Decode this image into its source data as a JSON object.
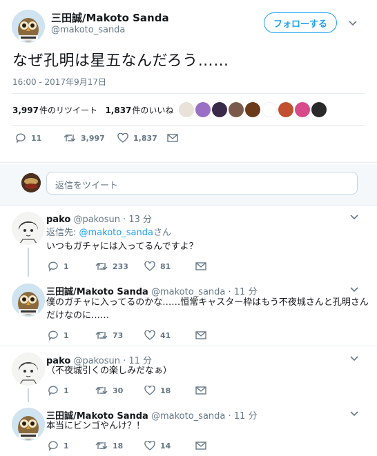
{
  "tweet": {
    "display_name": "三田誠/Makoto Sanda",
    "handle": "@makoto_sanda",
    "follow_label": "フォローする",
    "text": "なぜ孔明は星五なんだろう……",
    "timestamp": "16:00 - 2017年9月17日",
    "retweets_count": "3,997",
    "retweets_label": "件のリツイート",
    "likes_count": "1,837",
    "likes_label": "件のいいね",
    "actions": {
      "reply": "11",
      "retweet": "3,997",
      "like": "1,837"
    }
  },
  "reply_box": {
    "placeholder": "返信をツイート"
  },
  "replies": [
    {
      "name": "pako",
      "handle": "@pakosun",
      "time": "· 13 分",
      "replying_prefix": "返信先: ",
      "replying_to": "@makoto_sanda",
      "replying_suffix": "さん",
      "text": "いつもガチャには入ってるんですよ？",
      "reply": "1",
      "retweet": "233",
      "like": "81"
    },
    {
      "name": "三田誠/Makoto Sanda",
      "handle": "@makoto_sanda",
      "time": "· 11 分",
      "text1": "僕のガチャに入ってるのかな……恒常キャスター枠はもう不夜城さんと孔明さん",
      "text2": "だけなのに……",
      "reply": "1",
      "retweet": "73",
      "like": "41"
    },
    {
      "name": "pako",
      "handle": "@pakosun",
      "time": "· 11 分",
      "text": "（不夜城引くの楽しみだなぁ）",
      "reply": "1",
      "retweet": "30",
      "like": "18"
    },
    {
      "name": "三田誠/Makoto Sanda",
      "handle": "@makoto_sanda",
      "time": "· 11 分",
      "text": "本当にビンゴやんけ？！",
      "reply": "1",
      "retweet": "18",
      "like": "14"
    }
  ],
  "colors": {
    "accent": "#1da1f2",
    "muted": "#657786",
    "border": "#e6ecf0"
  }
}
